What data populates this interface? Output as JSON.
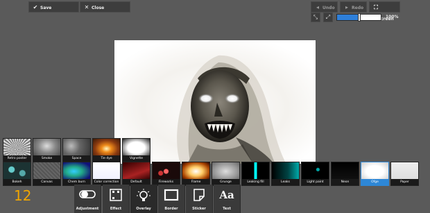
{
  "toolbar": {
    "save_label": "Save",
    "close_label": "Close",
    "undo_label": "Undo",
    "redo_label": "Redo",
    "fullscreen_label": "Fullscreen",
    "zoom_value": "100%",
    "zoom_fraction": 0.5
  },
  "effects_row1": [
    {
      "label": "Retro poster"
    },
    {
      "label": "Smoke"
    },
    {
      "label": "Space"
    },
    {
      "label": "Tie dye"
    },
    {
      "label": "Vignette"
    }
  ],
  "effects_row2": [
    {
      "label": "Bokeh"
    },
    {
      "label": "Canvas"
    },
    {
      "label": "Chem burn"
    },
    {
      "label": "Color correction"
    },
    {
      "label": "Default"
    },
    {
      "label": "Fireworks"
    },
    {
      "label": "Flame"
    },
    {
      "label": "Grunge"
    },
    {
      "label": "Leaking fill"
    },
    {
      "label": "Leaks"
    },
    {
      "label": "Light paint"
    },
    {
      "label": "Neon"
    },
    {
      "label": "Ofge",
      "selected": true
    },
    {
      "label": "Paper"
    }
  ],
  "counter": "12",
  "categories": [
    {
      "label": "Adjustment",
      "icon": "toggle-icon"
    },
    {
      "label": "Effect",
      "icon": "film-icon"
    },
    {
      "label": "Overlay",
      "icon": "bulb-icon"
    },
    {
      "label": "Border",
      "icon": "frame-icon"
    },
    {
      "label": "Sticker",
      "icon": "sticker-icon"
    },
    {
      "label": "Text",
      "icon": "text-icon"
    }
  ],
  "colors": {
    "accent": "#2e87d6",
    "counter": "#f0a500"
  }
}
